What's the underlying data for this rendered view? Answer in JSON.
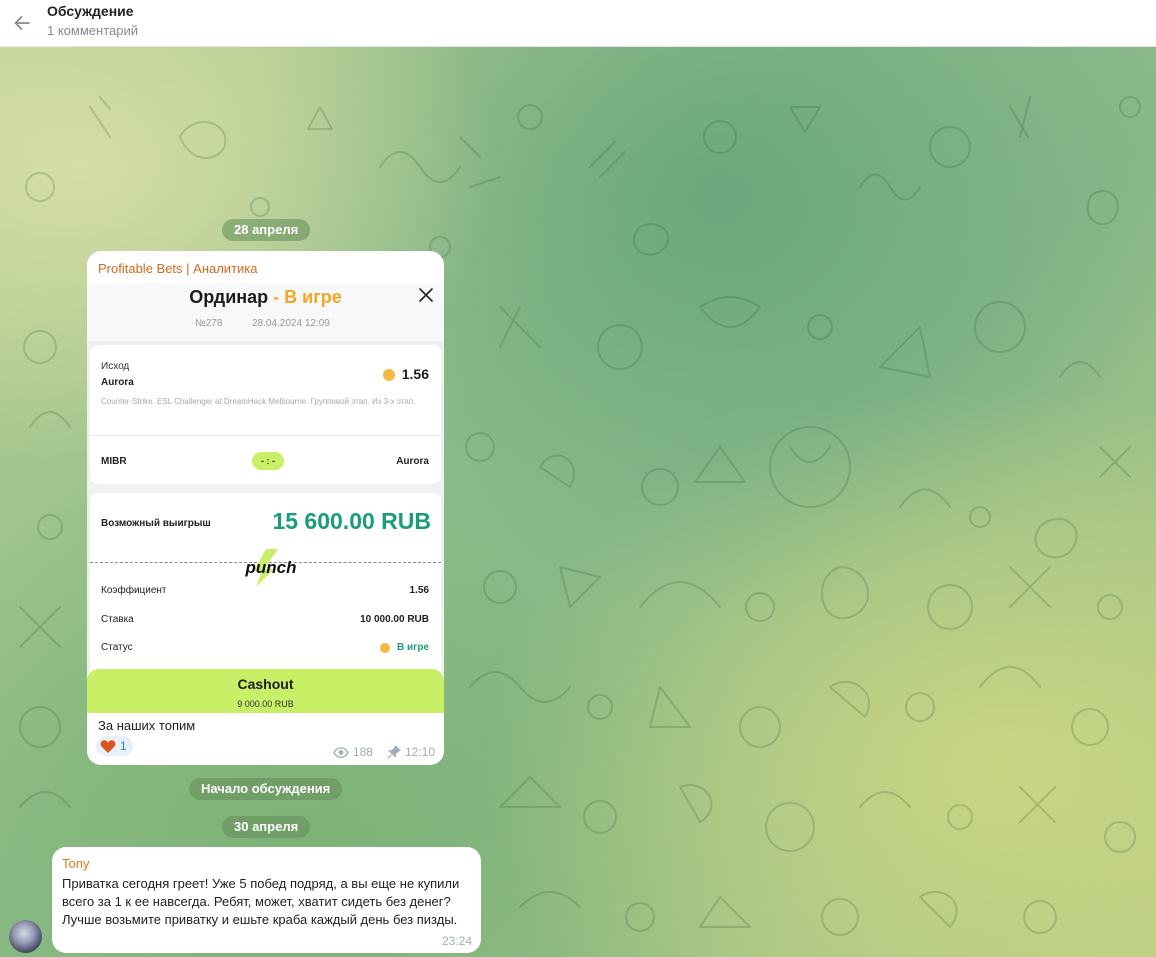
{
  "header": {
    "title": "Обсуждение",
    "subtitle": "1 комментарий"
  },
  "pills": {
    "date1": "28 апреля",
    "discussion_start": "Начало обсуждения",
    "date2": "30 апреля"
  },
  "post": {
    "author": "Profitable Bets | Аналитика",
    "bet": {
      "title_prefix": "Ординар",
      "title_status": " - В игре",
      "number": "№278",
      "datetime": "28.04.2024 12:09",
      "outcome_label": "Исход",
      "outcome_team": "Aurora",
      "coefficient": "1.56",
      "event_description": "Counter-Strike. ESL Challenger at DreamHack Melbourne. Групповой этап. Из 3-х этап.",
      "team1": "MIBR",
      "score": "- : -",
      "team2": "Aurora",
      "possible_win_label": "Возможный выигрыш",
      "possible_win_value": "15 600.00 RUB",
      "coef_label": "Коэффициент",
      "coef_value": "1.56",
      "stake_label": "Ставка",
      "stake_value": "10 000.00 RUB",
      "status_label": "Статус",
      "status_value": "В игре",
      "cashout_label": "Cashout",
      "cashout_amount": "9 000.00 RUB"
    },
    "text": "За наших топим",
    "reaction": {
      "icon": "heart",
      "count": "1"
    },
    "views": "188",
    "time": "12:10"
  },
  "comment": {
    "author": "Tony",
    "text": "Приватка сегодня греет! Уже 5 побед подряд, а вы еще не купили всего за 1 к ее навсегда. Ребят, может, хватит сидеть без денег? Лучше возьмите приватку и ешьте краба каждый день без пизды.",
    "time": "23:24"
  },
  "colors": {
    "accent_orange": "#f5a623",
    "win_green": "#1a9e7a",
    "lime": "#c8f067"
  }
}
